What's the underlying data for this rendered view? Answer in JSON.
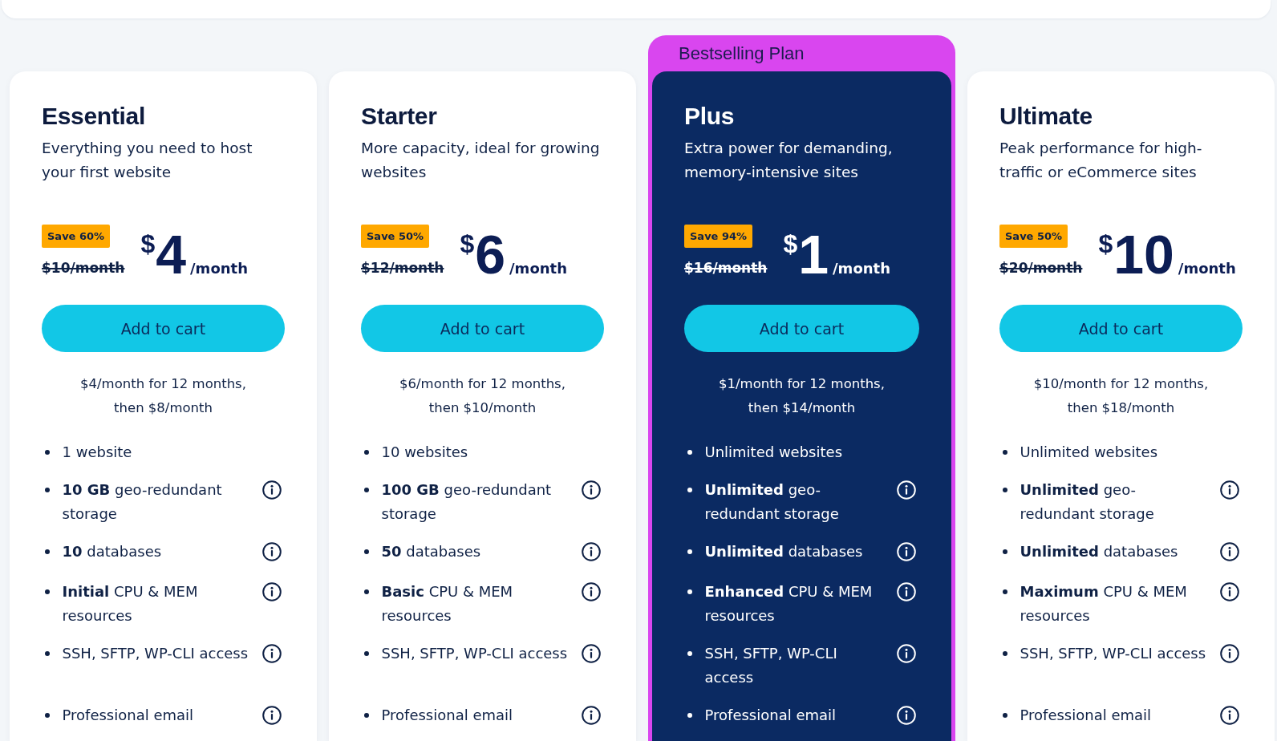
{
  "plans": [
    {
      "name": "Essential",
      "featured": false,
      "description": "Everything you need to host your first website",
      "badge": "Save 60%",
      "old_price": "$10/month",
      "currency": "$",
      "amount": "4",
      "period": "/month",
      "button": "Add to cart",
      "note": "$4/month for 12 months, then $8/month",
      "features": [
        {
          "text": "1 website",
          "info": false
        },
        {
          "text": "**10 GB** geo-redundant storage",
          "info": true
        },
        {
          "text": "**10** databases",
          "info": true
        },
        {
          "text": "**Initial** CPU & MEM resources",
          "info": true
        },
        {
          "text": "SSH, SFTP, WP-CLI access",
          "info": true
        },
        {
          "text": "Professional email",
          "info": true
        }
      ]
    },
    {
      "name": "Starter",
      "featured": false,
      "description": "More capacity, ideal for growing websites",
      "badge": "Save 50%",
      "old_price": "$12/month",
      "currency": "$",
      "amount": "6",
      "period": "/month",
      "button": "Add to cart",
      "note": "$6/month for 12 months, then $10/month",
      "features": [
        {
          "text": "10 websites",
          "info": false
        },
        {
          "text": "**100 GB** geo-redundant storage",
          "info": true
        },
        {
          "text": "**50** databases",
          "info": true
        },
        {
          "text": "**Basic** CPU & MEM resources",
          "info": true
        },
        {
          "text": "SSH, SFTP, WP-CLI access",
          "info": true
        },
        {
          "text": "Professional email",
          "info": true
        }
      ]
    },
    {
      "name": "Plus",
      "featured": true,
      "ribbon": "Bestselling Plan",
      "description": "Extra power for demanding, memory-intensive sites",
      "badge": "Save 94%",
      "old_price": "$16/month",
      "currency": "$",
      "amount": "1",
      "period": "/month",
      "button": "Add to cart",
      "note": "$1/month for 12 months, then $14/month",
      "features": [
        {
          "text": "Unlimited websites",
          "info": false
        },
        {
          "text": "**Unlimited** geo-redundant storage",
          "info": true
        },
        {
          "text": "**Unlimited** databases",
          "info": true
        },
        {
          "text": "**Enhanced** CPU & MEM resources",
          "info": true
        },
        {
          "text": "SSH, SFTP, WP-CLI access",
          "info": true
        },
        {
          "text": "Professional email",
          "info": true
        }
      ]
    },
    {
      "name": "Ultimate",
      "featured": false,
      "description": "Peak performance for high-traffic or eCommerce sites",
      "badge": "Save 50%",
      "old_price": "$20/month",
      "currency": "$",
      "amount": "10",
      "period": "/month",
      "button": "Add to cart",
      "note": "$10/month for 12 months, then $18/month",
      "features": [
        {
          "text": "Unlimited websites",
          "info": false
        },
        {
          "text": "**Unlimited** geo-redundant storage",
          "info": true
        },
        {
          "text": "**Unlimited** databases",
          "info": true
        },
        {
          "text": "**Maximum** CPU & MEM resources",
          "info": true
        },
        {
          "text": "SSH, SFTP, WP-CLI access",
          "info": true
        },
        {
          "text": "Professional email",
          "info": true
        }
      ]
    }
  ]
}
